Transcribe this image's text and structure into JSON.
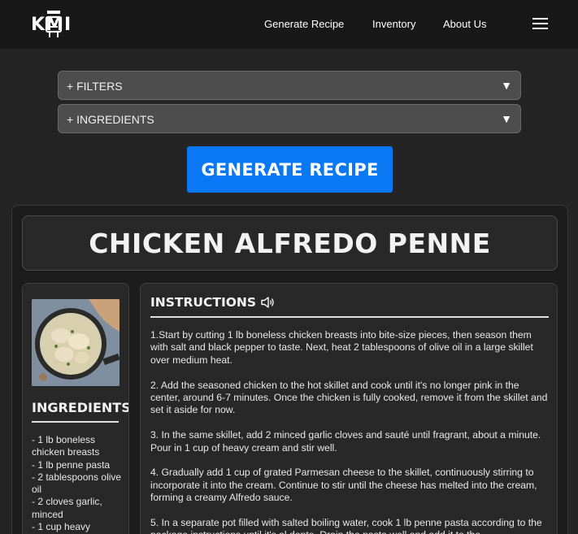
{
  "header": {
    "logo_text": "KMI",
    "nav": {
      "generate": "Generate Recipe",
      "inventory": "Inventory",
      "about": "About Us"
    },
    "menu_icon": "hamburger-icon"
  },
  "controls": {
    "filters_label": "+ FILTERS",
    "ingredients_label": "+ INGREDIENTS",
    "arrow": "▼",
    "generate_button": "GENERATE RECIPE"
  },
  "recipe": {
    "title": "CHICKEN ALFREDO PENNE",
    "ingredients_heading": "INGREDIENTS",
    "ingredients": [
      "- 1 lb boneless chicken breasts",
      "- 1 lb penne pasta",
      "- 2 tablespoons olive oil",
      "- 2 cloves garlic, minced",
      "- 1 cup heavy"
    ],
    "instructions_heading": "INSTRUCTIONS",
    "speaker_icon": "speaker-icon",
    "steps": [
      "1.Start by cutting 1 lb boneless chicken breasts into bite-size pieces, then season them with salt and black pepper to taste. Next, heat 2 tablespoons of olive oil in a large skillet over medium heat.",
      "2. Add the seasoned chicken to the hot skillet and cook until it's no longer pink in the center, around 6-7 minutes. Once the chicken is fully cooked, remove it from the skillet and set it aside for now.",
      "3. In the same skillet, add 2 minced garlic cloves and sauté until fragrant, about a minute. Pour in 1 cup of heavy cream and stir well.",
      "4. Gradually add 1 cup of grated Parmesan cheese to the skillet, continuously stirring to incorporate it into the cream. Continue to stir until the cheese has melted into the cream, forming a creamy Alfredo sauce.",
      "5. In a separate pot filled with salted boiling water, cook 1 lb penne pasta according to the package instructions until it's al dente. Drain the pasta well and add it to the"
    ]
  },
  "colors": {
    "background": "#242424",
    "topbar": "#181818",
    "accent": "#0a78f2",
    "panel": "#282828"
  }
}
